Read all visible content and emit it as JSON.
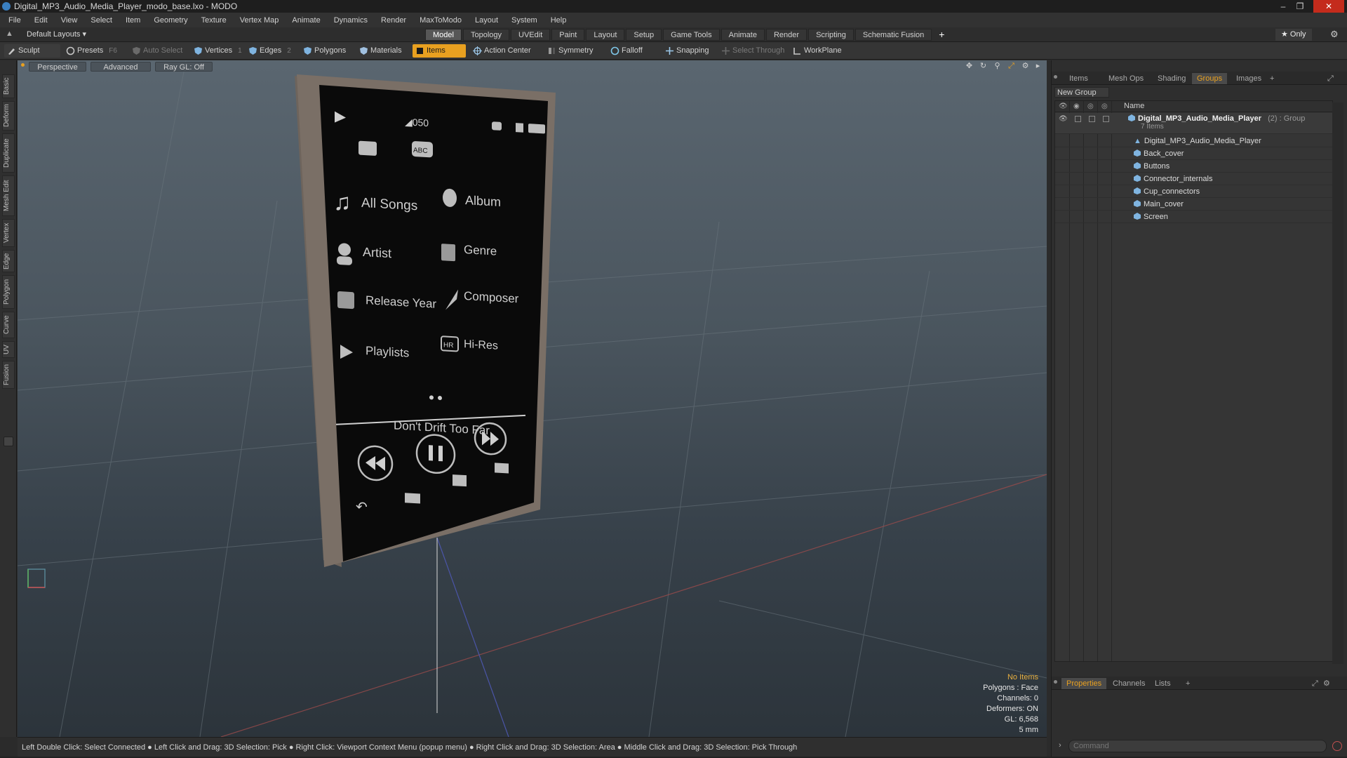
{
  "window": {
    "title": "Digital_MP3_Audio_Media_Player_modo_base.lxo - MODO"
  },
  "menu": [
    "File",
    "Edit",
    "View",
    "Select",
    "Item",
    "Geometry",
    "Texture",
    "Vertex Map",
    "Animate",
    "Dynamics",
    "Render",
    "MaxToModo",
    "Layout",
    "System",
    "Help"
  ],
  "layout": {
    "preset": "Default Layouts ▾",
    "tabs": [
      "Model",
      "Topology",
      "UVEdit",
      "Paint",
      "Layout",
      "Setup",
      "Game Tools",
      "Animate",
      "Render",
      "Scripting",
      "Schematic Fusion"
    ],
    "active_tab": "Model",
    "add": "+",
    "only": "★  Only"
  },
  "toolbar": {
    "sculpt": "Sculpt",
    "presets": "Presets",
    "presets_key": "F6",
    "auto_select": "Auto Select",
    "vertices": "Vertices",
    "vertices_key": "1",
    "edges": "Edges",
    "edges_key": "2",
    "polygons": "Polygons",
    "materials": "Materials",
    "items": "Items",
    "action_center": "Action Center",
    "symmetry": "Symmetry",
    "falloff": "Falloff",
    "snapping": "Snapping",
    "select_through": "Select Through",
    "workplane": "WorkPlane"
  },
  "left_tabs": [
    "Basic",
    "Deform",
    "Duplicate",
    "Mesh Edit",
    "Vertex",
    "Edge",
    "Polygon",
    "Curve",
    "UV",
    "Fusion"
  ],
  "viewport": {
    "perspective": "Perspective",
    "advanced": "Advanced",
    "raygl": "Ray GL: Off",
    "info": {
      "no_items": "No Items",
      "polygons": "Polygons : Face",
      "channels": "Channels: 0",
      "deformers": "Deformers: ON",
      "gl": "GL: 6,568",
      "scale": "5 mm"
    },
    "screen": {
      "volume": "◢050",
      "menu": [
        "All Songs",
        "Album",
        "Artist",
        "Genre",
        "Release Year",
        "Composer",
        "Playlists",
        "Hi-Res"
      ],
      "hires_badge": "HR",
      "abc": "ABC",
      "track": "Don't Drift Too Far"
    }
  },
  "statusbar": "Left Double Click: Select Connected ● Left Click and Drag: 3D Selection: Pick ● Right Click: Viewport Context Menu (popup menu) ● Right Click and Drag: 3D Selection: Area ● Middle Click and Drag: 3D Selection: Pick Through",
  "right_panel": {
    "tabs": [
      "Items",
      "Mesh Ops",
      "Shading",
      "Groups",
      "Images"
    ],
    "active_tab": "Groups",
    "new_group": "New Group",
    "name_col": "Name",
    "group": {
      "name": "Digital_MP3_Audio_Media_Player",
      "suffix": "(2) : Group",
      "count": "7 Items"
    },
    "items": [
      "Digital_MP3_Audio_Media_Player",
      "Back_cover",
      "Buttons",
      "Connector_internals",
      "Cup_connectors",
      "Main_cover",
      "Screen"
    ],
    "bottom_tabs": [
      "Properties",
      "Channels",
      "Lists"
    ],
    "bottom_active": "Properties",
    "command_placeholder": "Command"
  }
}
